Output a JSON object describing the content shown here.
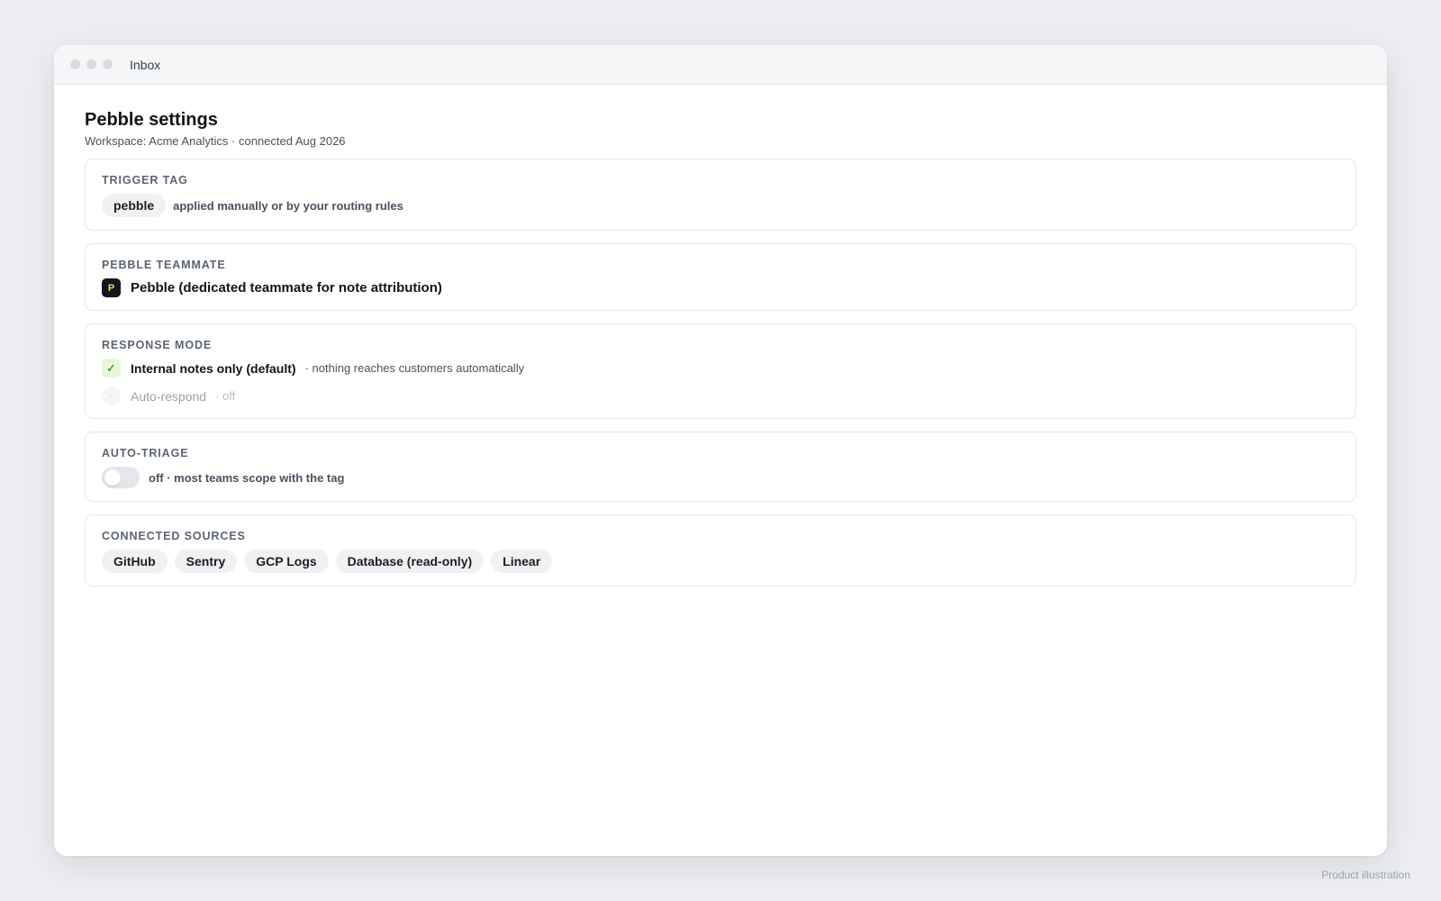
{
  "window": {
    "title": "Inbox"
  },
  "page": {
    "title": "Pebble settings",
    "subtitle": "Workspace: Acme Analytics · connected Aug 2026"
  },
  "trigger_tag": {
    "label": "TRIGGER TAG",
    "tag": "pebble",
    "hint": "applied manually or by your routing rules"
  },
  "teammate": {
    "label": "PEBBLE TEAMMATE",
    "avatar_letter": "P",
    "name": "Pebble (dedicated teammate for note attribution)"
  },
  "response_mode": {
    "label": "RESPONSE MODE",
    "options": [
      {
        "label": "Internal notes only (default)",
        "note": "· nothing reaches customers automatically",
        "selected": true,
        "icon": "check-icon",
        "glyph": "✓"
      },
      {
        "label": "Auto-respond",
        "note": "· off",
        "selected": false,
        "icon": "radio-icon",
        "glyph": "·"
      }
    ]
  },
  "auto_triage": {
    "label": "AUTO-TRIAGE",
    "enabled": false,
    "hint": "off · most teams scope with the tag"
  },
  "sources": {
    "label": "CONNECTED SOURCES",
    "items": [
      "GitHub",
      "Sentry",
      "GCP Logs",
      "Database (read-only)",
      "Linear"
    ]
  },
  "footer": {
    "note": "Product illustration"
  },
  "colors": {
    "avatar_bg": "#13171c",
    "avatar_fg": "#c6f04a",
    "check_bg": "#e8f6d8",
    "toggle_off": "#e3e6ea"
  }
}
